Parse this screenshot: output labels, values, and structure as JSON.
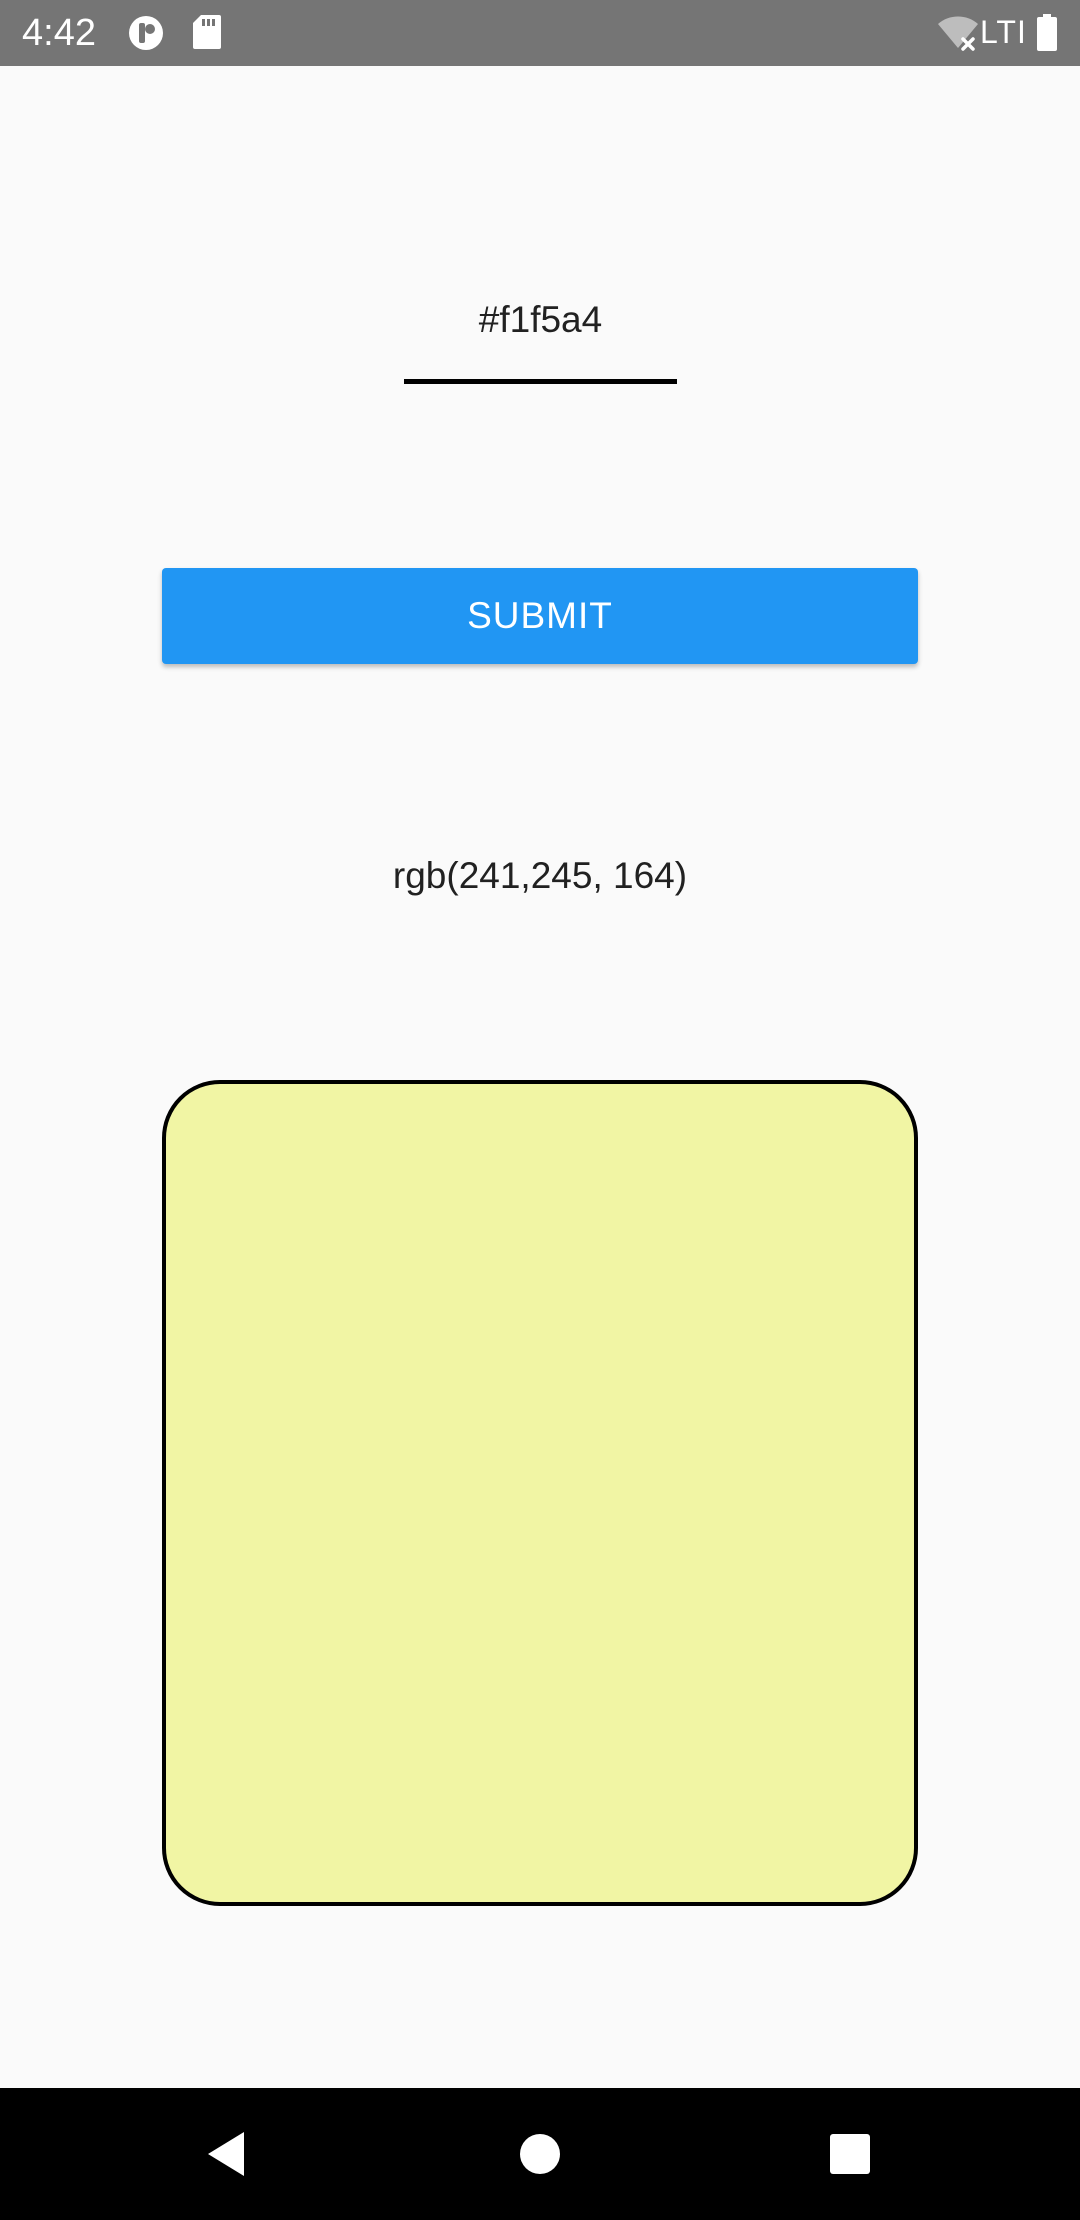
{
  "status_bar": {
    "time": "4:42",
    "network_label": "LTI",
    "icons": [
      "app-notification-icon",
      "sd-card-icon",
      "wifi-off-icon",
      "battery-icon"
    ]
  },
  "hex_input": {
    "value": "#f1f5a4"
  },
  "submit_button": {
    "label": "SUBMIT"
  },
  "rgb_output": {
    "text": "rgb(241,245, 164)"
  },
  "color_preview": {
    "color": "#f1f5a4"
  },
  "colors": {
    "status_bar_bg": "#757575",
    "page_bg": "#fafafa",
    "button_bg": "#2196f3",
    "nav_bar_bg": "#000000"
  },
  "nav_bar": {
    "icons": [
      "back-icon",
      "home-icon",
      "recents-icon"
    ]
  }
}
